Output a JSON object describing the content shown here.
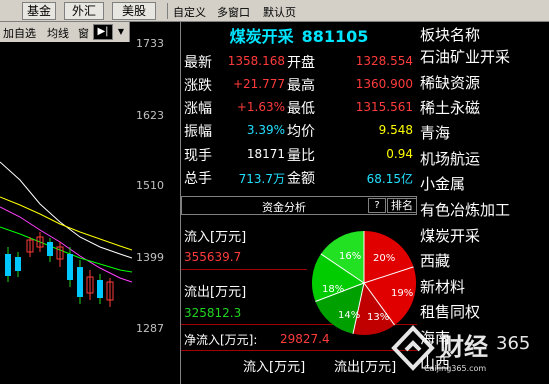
{
  "topbar": {
    "tabs": [
      "基金",
      "外汇",
      "美股"
    ],
    "toolbar": [
      "自定义",
      "多窗口",
      "默认页"
    ]
  },
  "chart_toolbar": {
    "items": [
      "加自选",
      "均线",
      "窗"
    ],
    "arrow_icon": "arrow-right-icon",
    "dropdown_icon": "chevron-down-icon"
  },
  "price_scale": [
    "1733",
    "1623",
    "1510",
    "1399",
    "1287"
  ],
  "quote": {
    "name": "煤炭开采",
    "code": "881105",
    "rows": [
      {
        "label": "最新",
        "value": "1358.168",
        "label2": "开盘",
        "value2": "1328.554"
      },
      {
        "label": "涨跌",
        "value": "+21.777",
        "label2": "最高",
        "value2": "1360.900"
      },
      {
        "label": "涨幅",
        "value": "+1.63%",
        "label2": "最低",
        "value2": "1315.561"
      },
      {
        "label": "振幅",
        "value": "3.39%",
        "label2": "均价",
        "value2": "9.548"
      },
      {
        "label": "现手",
        "value": "18171",
        "label2": "量比",
        "value2": "0.94"
      },
      {
        "label": "总手",
        "value": "713.7万",
        "label2": "金额",
        "value2": "68.15亿"
      }
    ],
    "fund_header": "资金分析",
    "help_btn": "?",
    "rank_btn": "排名",
    "inflow_label": "流入[万元]",
    "inflow_value": "355639.7",
    "outflow_label": "流出[万元]",
    "outflow_value": "325812.3",
    "net_label": "净流入[万元]:",
    "net_value": "29827.4",
    "col_heads": [
      "流入[万元]",
      "流出[万元]"
    ],
    "pie_labels": [
      "16%",
      "20%",
      "18%",
      "19%",
      "14%",
      "13%"
    ]
  },
  "sectors": {
    "title": "板块名称",
    "items": [
      "石油矿业开采",
      "稀缺资源",
      "稀土永磁",
      "青海",
      "机场航运",
      "小金属",
      "有色冶炼加工",
      "煤炭开采",
      "西藏",
      "新材料",
      "租售同权",
      "海南",
      "山西"
    ]
  },
  "watermark": {
    "text": "财经",
    "number": "365",
    "url": "Caijing365.com"
  },
  "colors": {
    "up": "#ff3b3b",
    "down": "#21d521",
    "accent": "#00e5ff",
    "background": "#000000"
  }
}
